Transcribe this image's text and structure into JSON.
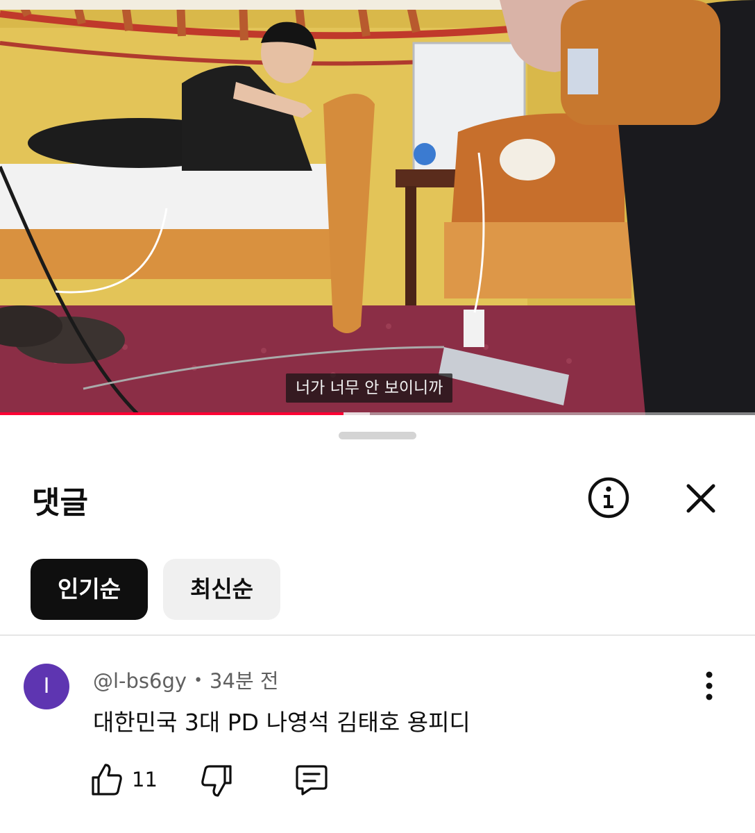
{
  "video": {
    "subtitle": "너가 너무 안 보이니까",
    "progress_played": 0.455,
    "progress_buffered": 0.49
  },
  "comments": {
    "title": "댓글",
    "info_icon": "info-icon",
    "close_icon": "close-icon",
    "sort": {
      "top_label": "인기순",
      "newest_label": "최신순",
      "selected": "인기순"
    },
    "items": [
      {
        "avatar_initial": "I",
        "avatar_color": "#5e35b1",
        "author": "@l-bs6gy",
        "time": "34분 전",
        "text": "대한민국 3대 PD 나영석 김태호 용피디",
        "like_count": "11"
      }
    ]
  },
  "colors": {
    "accent": "#ff0033",
    "chip_selected_bg": "#0f0f0f",
    "chip_bg": "#f0f0f0",
    "secondary_text": "#606060"
  }
}
